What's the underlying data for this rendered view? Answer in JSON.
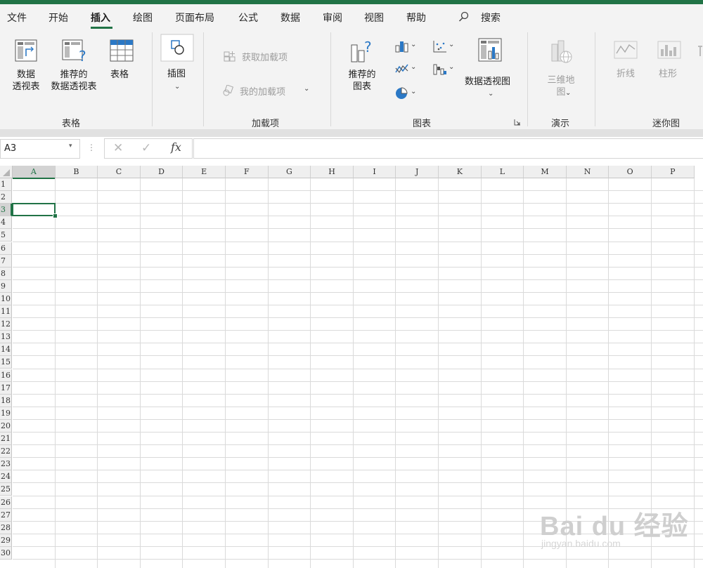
{
  "tabs": [
    "文件",
    "开始",
    "插入",
    "绘图",
    "页面布局",
    "公式",
    "数据",
    "审阅",
    "视图",
    "帮助"
  ],
  "active_tab": "插入",
  "search_label": "搜索",
  "groups": {
    "tables": {
      "label": "表格",
      "pivot": "数据\n透视表",
      "recommended_pivot": "推荐的\n数据透视表",
      "table": "表格"
    },
    "illustrations": {
      "insert_picture": "插图"
    },
    "addins": {
      "label": "加载项",
      "get_addins": "获取加载项",
      "my_addins": "我的加载项"
    },
    "charts": {
      "label": "图表",
      "recommended": "推荐的\n图表",
      "pivot_chart": "数据透视图"
    },
    "tours": {
      "label": "演示",
      "map3d": "三维地\n图"
    },
    "sparklines": {
      "label": "迷你图",
      "line": "折线",
      "column": "柱形"
    }
  },
  "formula_bar": {
    "name_box": "A3",
    "fx": "fx",
    "formula": ""
  },
  "columns": [
    "A",
    "B",
    "C",
    "D",
    "E",
    "F",
    "G",
    "H",
    "I",
    "J",
    "K",
    "L",
    "M",
    "N",
    "O",
    "P"
  ],
  "rows": [
    "1",
    "2",
    "3",
    "4",
    "5",
    "6",
    "7",
    "8",
    "9",
    "10",
    "11",
    "12",
    "13",
    "14",
    "15",
    "16",
    "17",
    "18",
    "19",
    "20",
    "21",
    "22",
    "23",
    "24",
    "25",
    "26",
    "27",
    "28",
    "29",
    "30"
  ],
  "selected_cell": {
    "col": "A",
    "row": "3"
  },
  "watermark": {
    "brand": "Bai du 经验",
    "url": "jingyan.baidu.com"
  },
  "colors": {
    "accent": "#217346"
  }
}
